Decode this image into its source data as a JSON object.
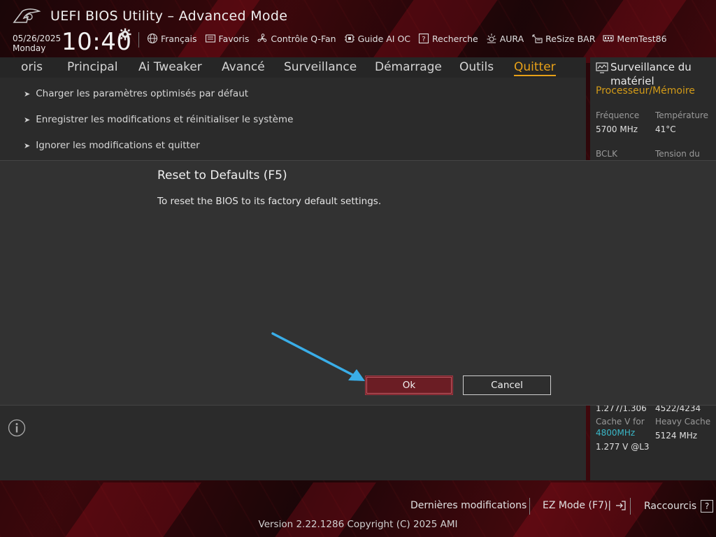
{
  "header": {
    "title": "UEFI BIOS Utility – Advanced Mode",
    "date": "05/26/2025",
    "weekday": "Monday",
    "time": "10:40",
    "toolbar": [
      {
        "label": "Français",
        "icon": "globe-icon"
      },
      {
        "label": "Favoris",
        "icon": "favorites-icon"
      },
      {
        "label": "Contrôle Q-Fan",
        "icon": "fan-icon"
      },
      {
        "label": "Guide AI OC",
        "icon": "ai-chip-icon"
      },
      {
        "label": "Recherche",
        "icon": "help-search-icon"
      },
      {
        "label": "AURA",
        "icon": "aura-light-icon"
      },
      {
        "label": "ReSize BAR",
        "icon": "resize-bar-icon"
      },
      {
        "label": "MemTest86",
        "icon": "memtest-icon"
      }
    ]
  },
  "tabs": [
    {
      "label": "oris",
      "active": false
    },
    {
      "label": "Principal",
      "active": false
    },
    {
      "label": "Ai Tweaker",
      "active": false
    },
    {
      "label": "Avancé",
      "active": false
    },
    {
      "label": "Surveillance",
      "active": false
    },
    {
      "label": "Démarrage",
      "active": false
    },
    {
      "label": "Outils",
      "active": false
    },
    {
      "label": "Quitter",
      "active": true
    }
  ],
  "menu": [
    "Charger les paramètres optimisés par défaut",
    "Enregistrer les modifications et réinitialiser le système",
    "Ignorer les modifications et quitter"
  ],
  "monitor": {
    "title": "Surveillance du matériel",
    "subtitle": "Processeur/Mémoire",
    "freq_label": "Fréquence",
    "freq_value": "5700 MHz",
    "temp_label": "Température",
    "temp_value": "41°C",
    "bclk_label": "BCLK",
    "tension_label": "Tension du",
    "v1": "1.277/1.306",
    "v2": "4522/4234",
    "cache_label": "Cache V for",
    "cache_freq": "4800MHz",
    "heavy_label": "Heavy Cache",
    "heavy_value": "5124 MHz",
    "l3_value": "1.277 V @L3"
  },
  "dialog": {
    "title": "Reset to Defaults (F5)",
    "message": "To reset the BIOS to its factory default settings.",
    "ok": "Ok",
    "cancel": "Cancel"
  },
  "footer": {
    "last_changes": "Dernières modifications",
    "ez_mode": "EZ Mode (F7)|",
    "shortcuts": "Raccourcis",
    "shortcuts_key": "?",
    "version": "Version 2.22.1286 Copyright (C) 2025 AMI"
  },
  "colors": {
    "accent": "#e8a118",
    "ok_button": "#6b1d24",
    "arrow": "#3aaee8",
    "cyan_value": "#3ab8c8"
  }
}
